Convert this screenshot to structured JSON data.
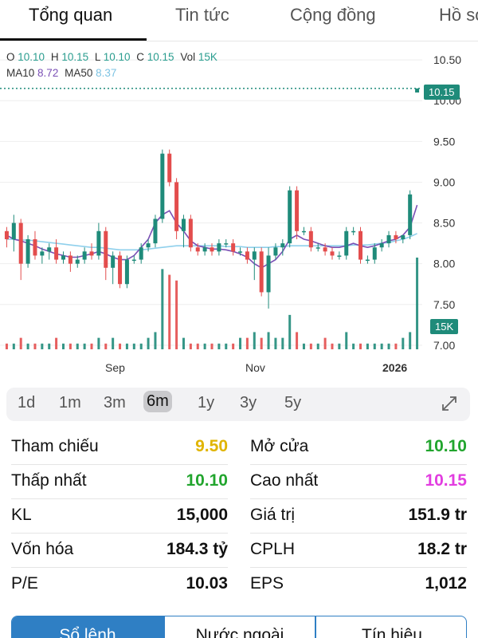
{
  "tabs": [
    {
      "label": "Tổng quan",
      "active": true
    },
    {
      "label": "Tin tức",
      "active": false
    },
    {
      "label": "Cộng đồng",
      "active": false
    },
    {
      "label": "Hồ sơ",
      "active": false
    }
  ],
  "ohlc": {
    "o_label": "O",
    "o": "10.10",
    "h_label": "H",
    "h": "10.15",
    "l_label": "L",
    "l": "10.10",
    "c_label": "C",
    "c": "10.15",
    "vol_label": "Vol",
    "vol": "15K"
  },
  "ma": {
    "ma10_label": "MA10",
    "ma10": "8.72",
    "ma50_label": "MA50",
    "ma50": "8.37"
  },
  "chart_data": {
    "type": "candlestick",
    "y_ticks": [
      "10.50",
      "10.00",
      "9.50",
      "9.00",
      "8.50",
      "8.00",
      "7.50",
      "7.00"
    ],
    "ylim": [
      6.95,
      10.55
    ],
    "x_ticks": [
      "Sep",
      "Nov",
      "2026"
    ],
    "last_price_tag": "10.15",
    "volume_tag": "15K",
    "colors": {
      "up": "#1f8b7a",
      "down": "#e34d4d",
      "ma10": "#7a4fb5",
      "ma50": "#8fd0ec"
    },
    "candles": [
      [
        8.4,
        8.45,
        8.2,
        8.3
      ],
      [
        8.3,
        8.6,
        8.15,
        8.5
      ],
      [
        8.5,
        8.55,
        7.8,
        8.0
      ],
      [
        8.0,
        8.35,
        7.95,
        8.3
      ],
      [
        8.3,
        8.4,
        8.05,
        8.1
      ],
      [
        8.1,
        8.2,
        8.0,
        8.15
      ],
      [
        8.15,
        8.25,
        8.05,
        8.2
      ],
      [
        8.2,
        8.3,
        8.0,
        8.05
      ],
      [
        8.05,
        8.15,
        8.0,
        8.1
      ],
      [
        8.1,
        8.15,
        7.9,
        8.0
      ],
      [
        8.0,
        8.1,
        7.95,
        8.05
      ],
      [
        8.05,
        8.2,
        8.0,
        8.15
      ],
      [
        8.15,
        8.25,
        8.05,
        8.1
      ],
      [
        8.1,
        8.5,
        8.05,
        8.4
      ],
      [
        8.4,
        8.45,
        7.8,
        7.95
      ],
      [
        7.95,
        8.15,
        7.75,
        8.1
      ],
      [
        8.1,
        8.15,
        7.7,
        7.75
      ],
      [
        7.75,
        8.1,
        7.7,
        8.05
      ],
      [
        8.05,
        8.1,
        8.0,
        8.05
      ],
      [
        8.05,
        8.25,
        8.0,
        8.2
      ],
      [
        8.2,
        8.3,
        8.15,
        8.25
      ],
      [
        8.25,
        8.6,
        8.2,
        8.55
      ],
      [
        8.55,
        9.4,
        8.5,
        9.35
      ],
      [
        9.35,
        9.4,
        8.95,
        9.0
      ],
      [
        9.0,
        9.05,
        8.3,
        8.4
      ],
      [
        8.4,
        8.6,
        8.2,
        8.55
      ],
      [
        8.55,
        8.6,
        8.15,
        8.2
      ],
      [
        8.2,
        8.25,
        8.1,
        8.15
      ],
      [
        8.15,
        8.25,
        8.1,
        8.2
      ],
      [
        8.2,
        8.25,
        8.1,
        8.15
      ],
      [
        8.15,
        8.3,
        8.1,
        8.25
      ],
      [
        8.25,
        8.3,
        8.2,
        8.25
      ],
      [
        8.25,
        8.3,
        8.1,
        8.15
      ],
      [
        8.15,
        8.2,
        8.1,
        8.15
      ],
      [
        8.15,
        8.2,
        8.0,
        8.05
      ],
      [
        8.05,
        8.2,
        7.8,
        8.15
      ],
      [
        8.15,
        8.2,
        7.6,
        7.65
      ],
      [
        7.65,
        8.2,
        7.45,
        8.1
      ],
      [
        8.1,
        8.25,
        8.05,
        8.2
      ],
      [
        8.2,
        8.3,
        8.1,
        8.25
      ],
      [
        8.25,
        8.95,
        8.2,
        8.9
      ],
      [
        8.9,
        8.95,
        8.3,
        8.4
      ],
      [
        8.4,
        8.45,
        8.35,
        8.4
      ],
      [
        8.4,
        8.45,
        8.15,
        8.2
      ],
      [
        8.2,
        8.25,
        8.15,
        8.2
      ],
      [
        8.2,
        8.25,
        8.1,
        8.15
      ],
      [
        8.15,
        8.2,
        8.05,
        8.1
      ],
      [
        8.1,
        8.15,
        8.05,
        8.1
      ],
      [
        8.1,
        8.45,
        8.05,
        8.4
      ],
      [
        8.4,
        8.45,
        8.35,
        8.4
      ],
      [
        8.4,
        8.45,
        8.0,
        8.05
      ],
      [
        8.05,
        8.1,
        8.0,
        8.05
      ],
      [
        8.05,
        8.25,
        8.0,
        8.2
      ],
      [
        8.2,
        8.3,
        8.15,
        8.25
      ],
      [
        8.25,
        8.4,
        8.2,
        8.35
      ],
      [
        8.35,
        8.4,
        8.25,
        8.3
      ],
      [
        8.3,
        8.35,
        8.25,
        8.35
      ],
      [
        8.35,
        8.9,
        8.3,
        8.85
      ],
      [
        10.1,
        10.15,
        10.1,
        10.15
      ]
    ],
    "ma10": [
      8.35,
      8.3,
      8.28,
      8.25,
      8.22,
      8.18,
      8.15,
      8.12,
      8.1,
      8.08,
      8.08,
      8.1,
      8.12,
      8.15,
      8.12,
      8.08,
      8.05,
      8.05,
      8.1,
      8.2,
      8.3,
      8.5,
      8.6,
      8.65,
      8.5,
      8.4,
      8.28,
      8.22,
      8.2,
      8.18,
      8.18,
      8.17,
      8.15,
      8.12,
      8.08,
      8.0,
      7.95,
      8.0,
      8.05,
      8.15,
      8.3,
      8.35,
      8.3,
      8.28,
      8.25,
      8.22,
      8.2,
      8.2,
      8.22,
      8.25,
      8.22,
      8.2,
      8.22,
      8.25,
      8.28,
      8.3,
      8.35,
      8.45,
      8.72
    ],
    "ma50": [
      8.3,
      8.3,
      8.29,
      8.29,
      8.28,
      8.27,
      8.26,
      8.25,
      8.24,
      8.23,
      8.22,
      8.21,
      8.2,
      8.2,
      8.19,
      8.18,
      8.17,
      8.17,
      8.17,
      8.17,
      8.18,
      8.19,
      8.2,
      8.21,
      8.22,
      8.22,
      8.22,
      8.22,
      8.22,
      8.22,
      8.22,
      8.21,
      8.21,
      8.21,
      8.2,
      8.2,
      8.2,
      8.2,
      8.21,
      8.21,
      8.22,
      8.22,
      8.22,
      8.22,
      8.22,
      8.22,
      8.22,
      8.22,
      8.22,
      8.23,
      8.23,
      8.23,
      8.24,
      8.25,
      8.26,
      8.28,
      8.3,
      8.33,
      8.37
    ],
    "volumes": [
      1,
      1,
      2,
      1,
      1,
      1,
      1,
      2,
      1,
      1,
      1,
      1,
      1,
      2,
      1,
      2,
      1,
      1,
      1,
      1,
      2,
      3,
      14,
      13,
      12,
      2,
      1,
      1,
      1,
      1,
      1,
      1,
      1,
      2,
      2,
      3,
      2,
      3,
      2,
      2,
      6,
      3,
      1,
      1,
      1,
      2,
      1,
      1,
      3,
      1,
      1,
      1,
      1,
      1,
      1,
      1,
      2,
      3,
      16
    ]
  },
  "ranges": [
    {
      "label": "1d",
      "active": false
    },
    {
      "label": "1m",
      "active": false
    },
    {
      "label": "3m",
      "active": false
    },
    {
      "label": "6m",
      "active": true
    },
    {
      "label": "1y",
      "active": false
    },
    {
      "label": "3y",
      "active": false
    },
    {
      "label": "5y",
      "active": false
    }
  ],
  "stats": [
    {
      "left_label": "Tham chiếu",
      "left_value": "9.50",
      "left_color": "#e0b400",
      "right_label": "Mở cửa",
      "right_value": "10.10",
      "right_color": "#22a52e"
    },
    {
      "left_label": "Thấp nhất",
      "left_value": "10.10",
      "left_color": "#22a52e",
      "right_label": "Cao nhất",
      "right_value": "10.15",
      "right_color": "#e23de0"
    },
    {
      "left_label": "KL",
      "left_value": "15,000",
      "left_color": "#111111",
      "right_label": "Giá trị",
      "right_value": "151.9 tr",
      "right_color": "#111111"
    },
    {
      "left_label": "Vốn hóa",
      "left_value": "184.3 tỷ",
      "left_color": "#111111",
      "right_label": "CPLH",
      "right_value": "18.2 tr",
      "right_color": "#111111"
    },
    {
      "left_label": "P/E",
      "left_value": "10.03",
      "left_color": "#111111",
      "right_label": "EPS",
      "right_value": "1,012",
      "right_color": "#111111"
    }
  ],
  "segments": [
    {
      "label": "Sổ lệnh",
      "active": true
    },
    {
      "label": "Nước ngoài",
      "active": false
    },
    {
      "label": "Tín hiệu",
      "active": false
    }
  ]
}
